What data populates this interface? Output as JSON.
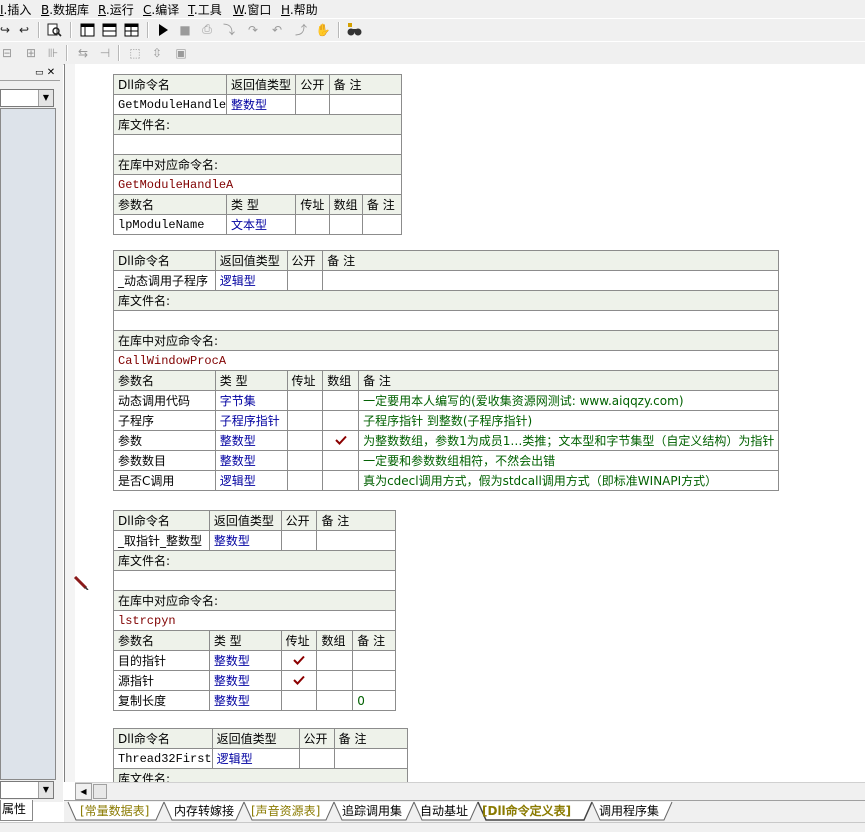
{
  "menu": [
    {
      "key": "I",
      "label": ".插入"
    },
    {
      "key": "B",
      "label": ".数据库"
    },
    {
      "key": "R",
      "label": ".运行"
    },
    {
      "key": "C",
      "label": ".编译"
    },
    {
      "key": "T",
      "label": ".工具"
    },
    {
      "key": "W",
      "label": ".窗口"
    },
    {
      "key": "H",
      "label": ".帮助"
    }
  ],
  "left_panel": {
    "tab_label": "属性"
  },
  "dll_tables": [
    {
      "headers": {
        "name": "Dll命令名",
        "return_type": "返回值类型",
        "public": "公开",
        "remark": "备 注"
      },
      "name": "GetModuleHandle",
      "return_type": "整数型",
      "public": "",
      "remark": "",
      "lib_label": "库文件名:",
      "lib_value": "",
      "entry_label": "在库中对应命令名:",
      "entry_value": "GetModuleHandleA",
      "param_headers": {
        "name": "参数名",
        "type": "类 型",
        "byref": "传址",
        "array": "数组",
        "remark": "备 注"
      },
      "params": [
        {
          "name": "lpModuleName",
          "type": "文本型",
          "byref": false,
          "array": false,
          "remark": ""
        }
      ]
    },
    {
      "headers": {
        "name": "Dll命令名",
        "return_type": "返回值类型",
        "public": "公开",
        "remark": "备 注"
      },
      "name": "_动态调用子程序",
      "return_type": "逻辑型",
      "public": "",
      "remark": "",
      "lib_label": "库文件名:",
      "lib_value": "",
      "entry_label": "在库中对应命令名:",
      "entry_value": "CallWindowProcA",
      "param_headers": {
        "name": "参数名",
        "type": "类 型",
        "byref": "传址",
        "array": "数组",
        "remark": "备 注"
      },
      "params": [
        {
          "name": "动态调用代码",
          "type": "字节集",
          "byref": false,
          "array": false,
          "remark": "一定要用本人编写的(爱收集资源网测试: www.aiqqzy.com)"
        },
        {
          "name": "子程序",
          "type": "子程序指针",
          "byref": false,
          "array": false,
          "remark": "子程序指针  到整数(子程序指针)"
        },
        {
          "name": "参数",
          "type": "整数型",
          "byref": false,
          "array": true,
          "remark": "为整数数组，参数1为成员1…类推；文本型和字节集型（自定义结构）为指针"
        },
        {
          "name": "参数数目",
          "type": "整数型",
          "byref": false,
          "array": false,
          "remark": "一定要和参数数组相符，不然会出错"
        },
        {
          "name": "是否C调用",
          "type": "逻辑型",
          "byref": false,
          "array": false,
          "remark": "真为cdecl调用方式，假为stdcall调用方式（即标准WINAPI方式）"
        }
      ]
    },
    {
      "headers": {
        "name": "Dll命令名",
        "return_type": "返回值类型",
        "public": "公开",
        "remark": "备 注"
      },
      "name": "_取指针_整数型",
      "return_type": "整数型",
      "public": "",
      "remark": "",
      "lib_label": "库文件名:",
      "lib_value": "",
      "entry_label": "在库中对应命令名:",
      "entry_value": "lstrcpyn",
      "param_headers": {
        "name": "参数名",
        "type": "类 型",
        "byref": "传址",
        "array": "数组",
        "remark": "备 注"
      },
      "params": [
        {
          "name": "目的指针",
          "type": "整数型",
          "byref": true,
          "array": false,
          "remark": ""
        },
        {
          "name": "源指针",
          "type": "整数型",
          "byref": true,
          "array": false,
          "remark": ""
        },
        {
          "name": "复制长度",
          "type": "整数型",
          "byref": false,
          "array": false,
          "remark": "0"
        }
      ]
    },
    {
      "headers": {
        "name": "Dll命令名",
        "return_type": "返回值类型",
        "public": "公开",
        "remark": "备 注"
      },
      "name": "Thread32First",
      "return_type": "逻辑型",
      "public": "",
      "remark": "",
      "lib_label": "库文件名:"
    }
  ],
  "bottom_tabs": [
    {
      "label": "[常量数据表]",
      "style": "res"
    },
    {
      "label": "内存转嫁接",
      "style": ""
    },
    {
      "label": "[声音资源表]",
      "style": "res"
    },
    {
      "label": "追踪调用集",
      "style": ""
    },
    {
      "label": "自动基址",
      "style": ""
    },
    {
      "label": "[Dll命令定义表]",
      "style": "active"
    },
    {
      "label": "调用程序集",
      "style": ""
    }
  ],
  "icons": {
    "check": "check-icon",
    "pencil": "pencil-icon"
  },
  "colors": {
    "type_text": "#0000a0",
    "entry_text": "#800000",
    "remark_text": "#006000",
    "header_bg": "#eef2ea",
    "check_mark": "#8b0000"
  }
}
